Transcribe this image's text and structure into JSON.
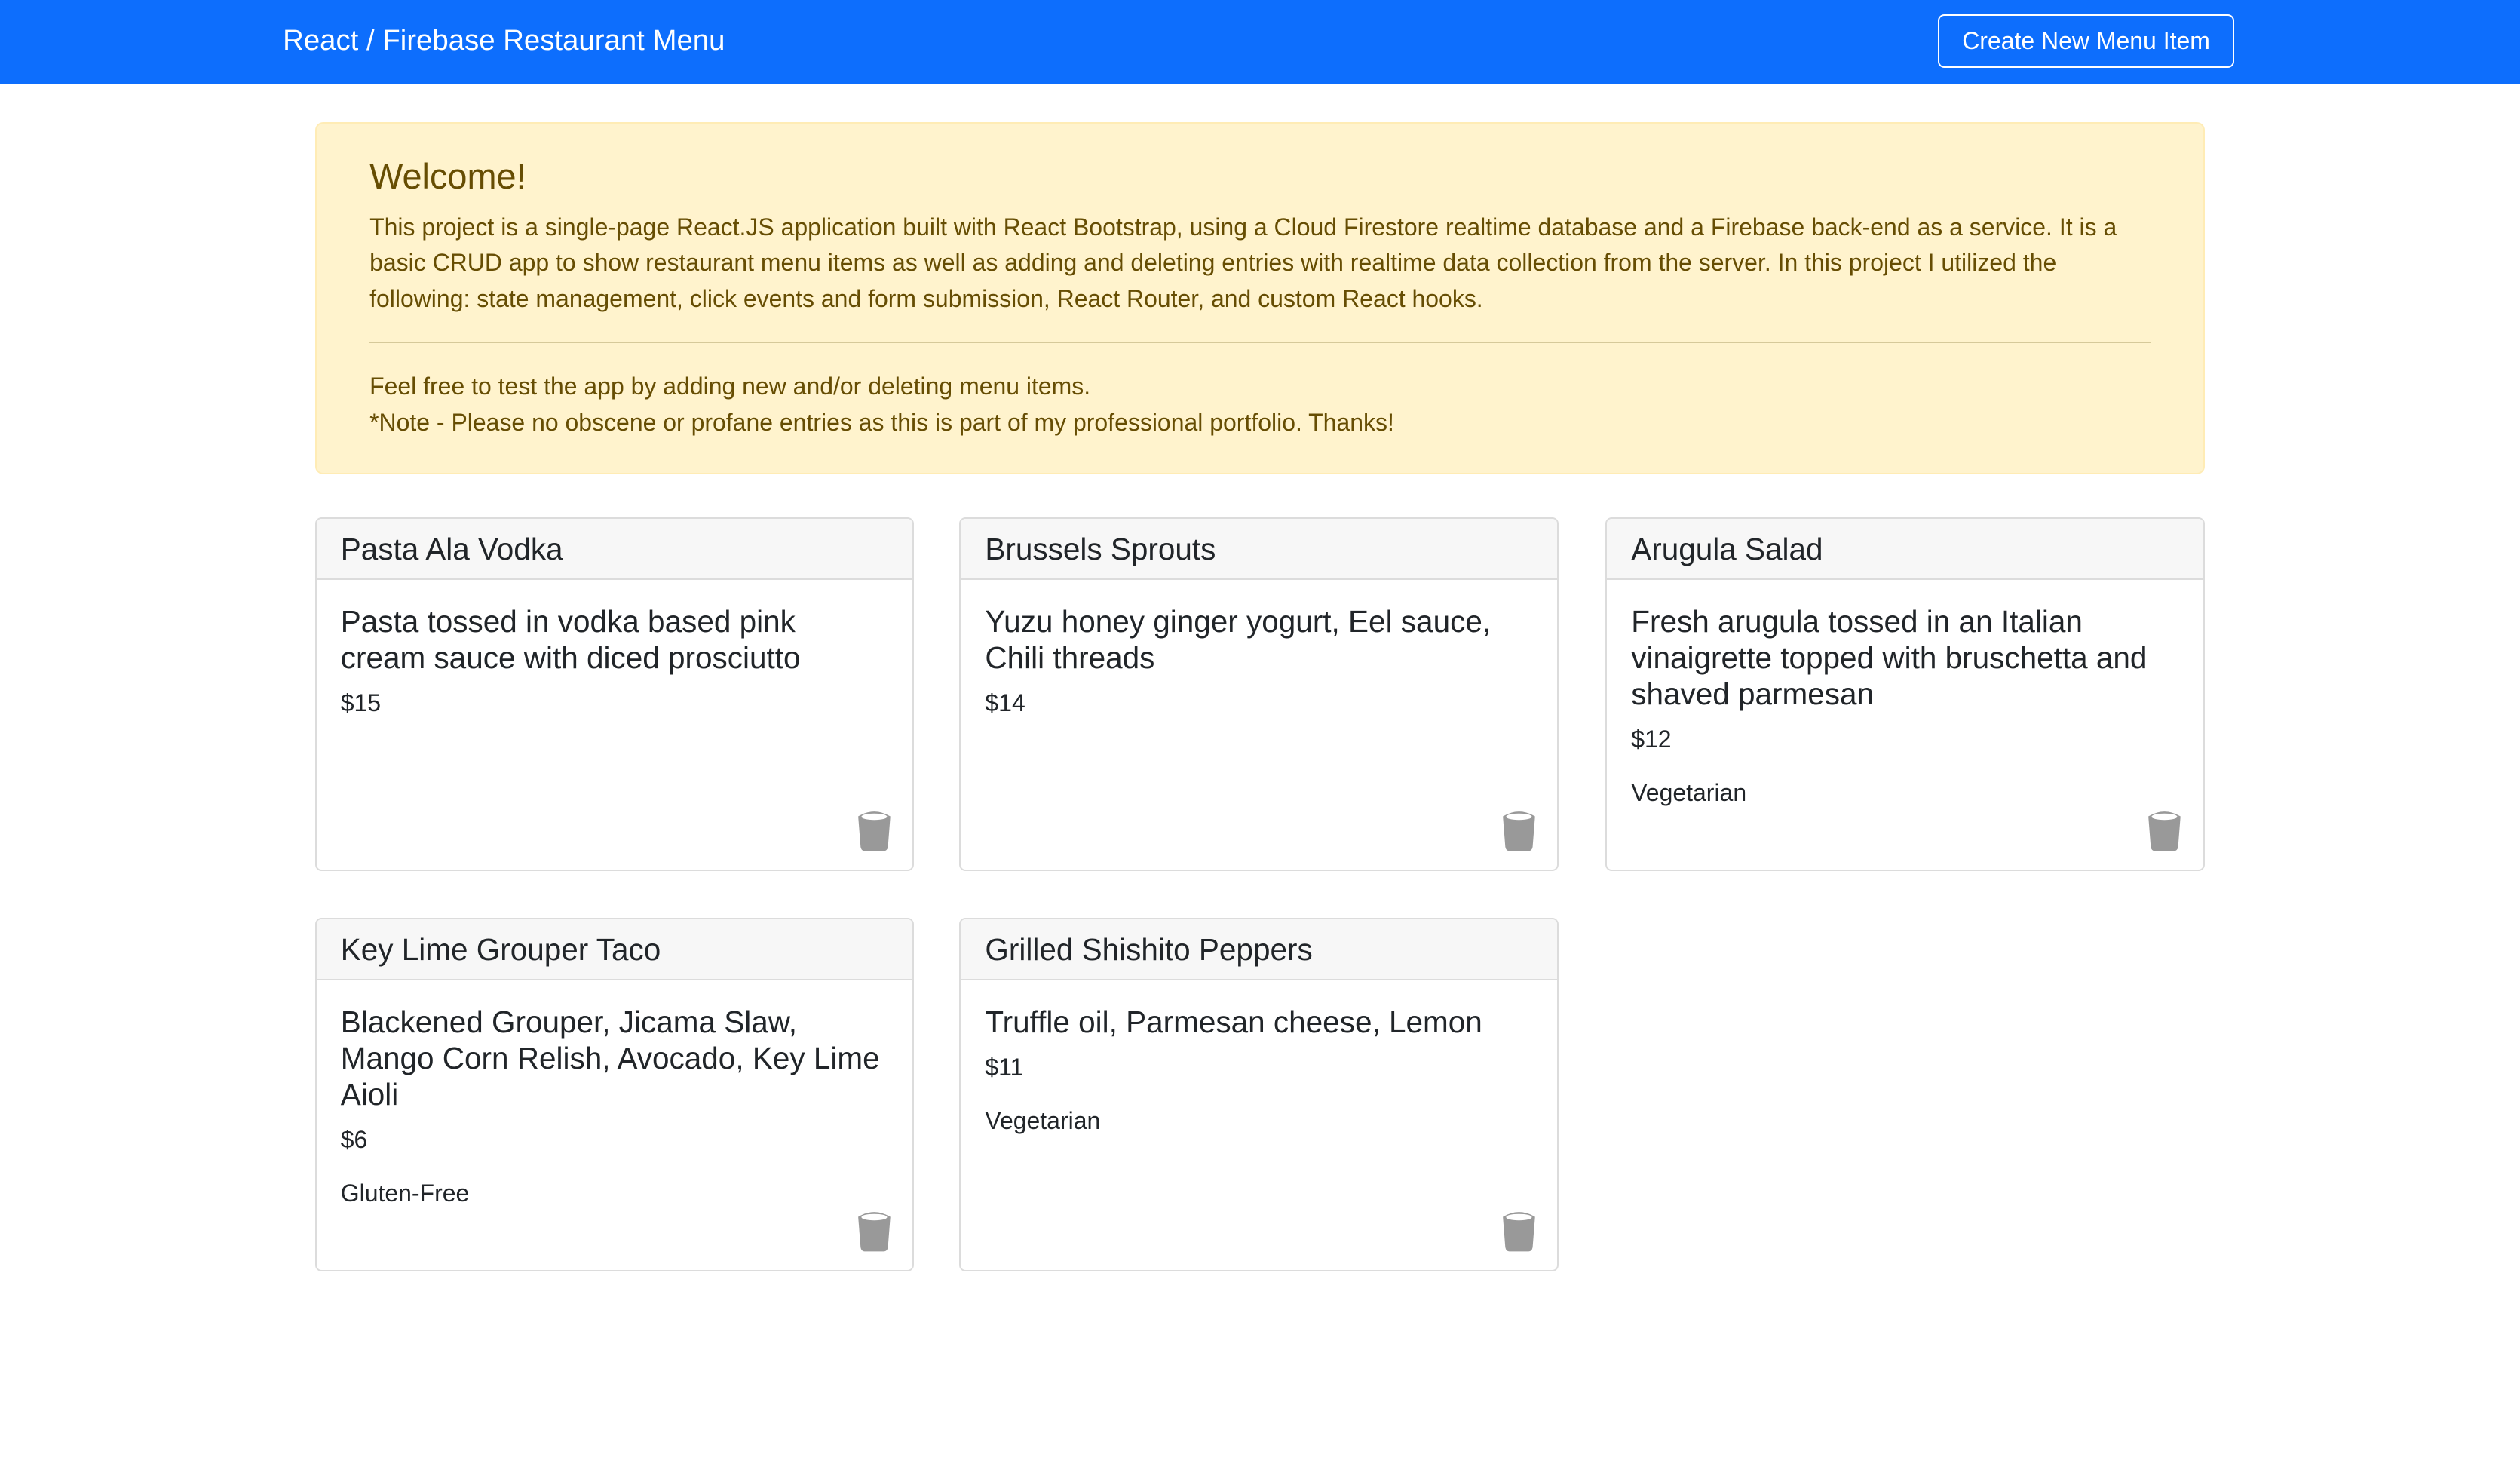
{
  "navbar": {
    "brand": "React / Firebase Restaurant Menu",
    "create_button": "Create New Menu Item",
    "color": "#0d6efd"
  },
  "alert": {
    "heading": "Welcome!",
    "body": "This project is a single-page React.JS application built with React Bootstrap, using a Cloud Firestore realtime database and a Firebase back-end as a service. It is a basic CRUD app to show restaurant menu items as well as adding and deleting entries with realtime data collection from the server. In this project I utilized the following: state management, click events and form submission, React Router, and custom React hooks.",
    "line1": "Feel free to test the app by adding new and/or deleting menu items.",
    "line2": "*Note - Please no obscene or profane entries as this is part of my professional portfolio. Thanks!"
  },
  "menu_items": [
    {
      "name": "Pasta Ala Vodka",
      "description": "Pasta tossed in vodka based pink cream sauce with diced prosciutto",
      "price": "$15",
      "diet": ""
    },
    {
      "name": "Brussels Sprouts",
      "description": "Yuzu honey ginger yogurt, Eel sauce, Chili threads",
      "price": "$14",
      "diet": ""
    },
    {
      "name": "Arugula Salad",
      "description": "Fresh arugula tossed in an Italian vinaigrette topped with bruschetta and shaved parmesan",
      "price": "$12",
      "diet": "Vegetarian"
    },
    {
      "name": "Key Lime Grouper Taco",
      "description": "Blackened Grouper, Jicama Slaw, Mango Corn Relish, Avocado, Key Lime Aioli",
      "price": "$6",
      "diet": "Gluten-Free"
    },
    {
      "name": "Grilled Shishito Peppers",
      "description": "Truffle oil, Parmesan cheese, Lemon",
      "price": "$11",
      "diet": "Vegetarian"
    }
  ],
  "icons": {
    "delete": "trash-icon"
  }
}
